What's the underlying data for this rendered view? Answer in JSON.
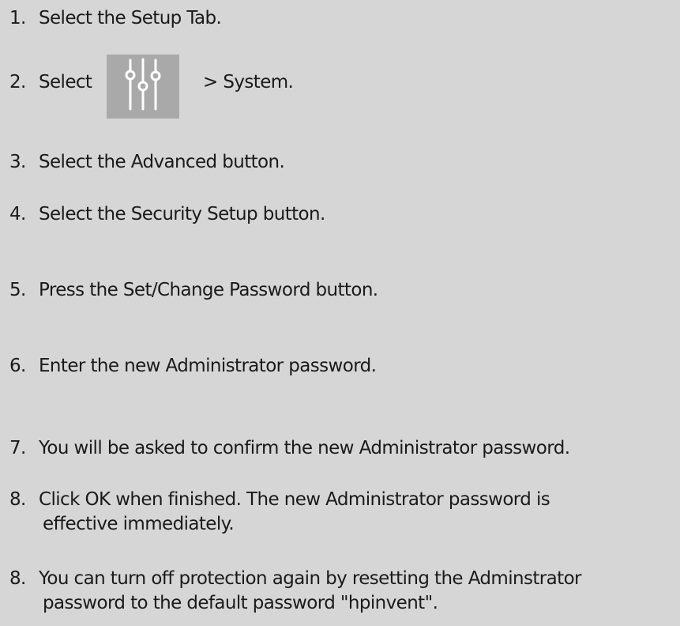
{
  "steps": [
    {
      "num": "1.",
      "text": "Select the Setup Tab."
    },
    {
      "num": "2.",
      "before": "Select",
      "icon": "sliders-icon",
      "after": "> System."
    },
    {
      "num": "3.",
      "text": "Select the Advanced button."
    },
    {
      "num": "4.",
      "text": "Select the Security Setup button."
    },
    {
      "num": "5.",
      "text": "Press the Set/Change Password button."
    },
    {
      "num": "6.",
      "text": "Enter the new Administrator password."
    },
    {
      "num": "7.",
      "text": "You will be asked to confirm the new Administrator password."
    },
    {
      "num": "8.",
      "line1": "Click OK when finished. The new Administrator password is",
      "line2": "effective immediately."
    },
    {
      "num": "8.",
      "line1": "You can turn off protection again by resetting the Adminstrator",
      "line2": "password to the default password \"hpinvent\"."
    }
  ],
  "colors": {
    "background": "#d6d6d6",
    "icon_tile": "#a9a9a9",
    "icon_glyph": "#ffffff",
    "text": "#1a1a1a"
  }
}
